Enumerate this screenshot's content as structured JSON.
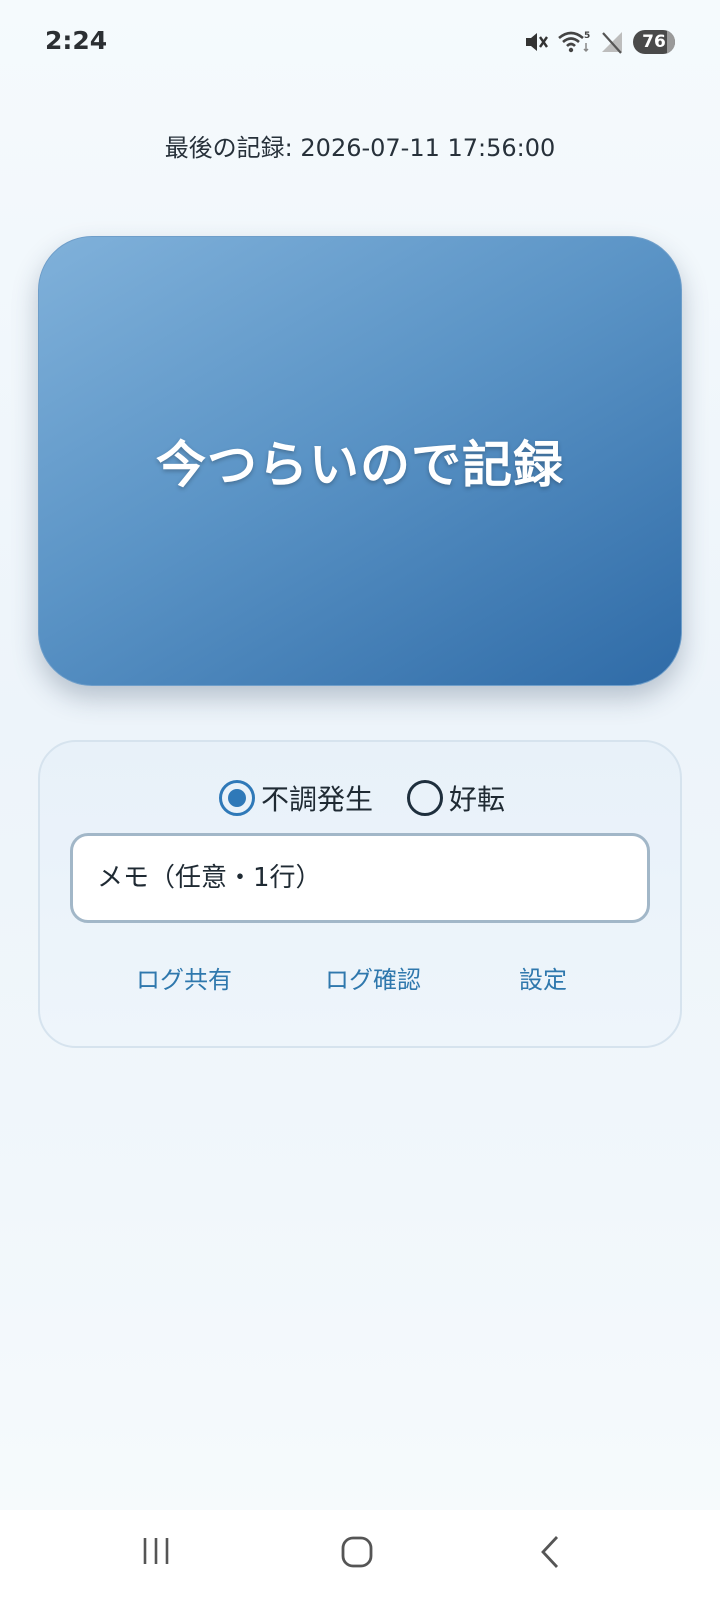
{
  "status_bar": {
    "time": "2:24",
    "battery": "76",
    "icons": [
      "mute-icon",
      "wifi-icon",
      "signal-off-icon"
    ]
  },
  "last_record": {
    "text": "最後の記録: 2026-07-11 17:56:00"
  },
  "record_button": {
    "label": "今つらいので記録"
  },
  "panel": {
    "radio_options": [
      {
        "label": "不調発生",
        "selected": true
      },
      {
        "label": "好転",
        "selected": false
      }
    ],
    "memo_placeholder": "メモ（任意・1行）",
    "links": {
      "share": "ログ共有",
      "view": "ログ確認",
      "settings": "設定"
    }
  },
  "nav_bar": {
    "icons": [
      "recent-apps-icon",
      "home-icon",
      "back-icon"
    ]
  },
  "colors": {
    "accent": "#2f79b8",
    "button_gradient_start": "#80b1da",
    "button_gradient_end": "#2f6ba7",
    "link": "#2f78ad"
  }
}
